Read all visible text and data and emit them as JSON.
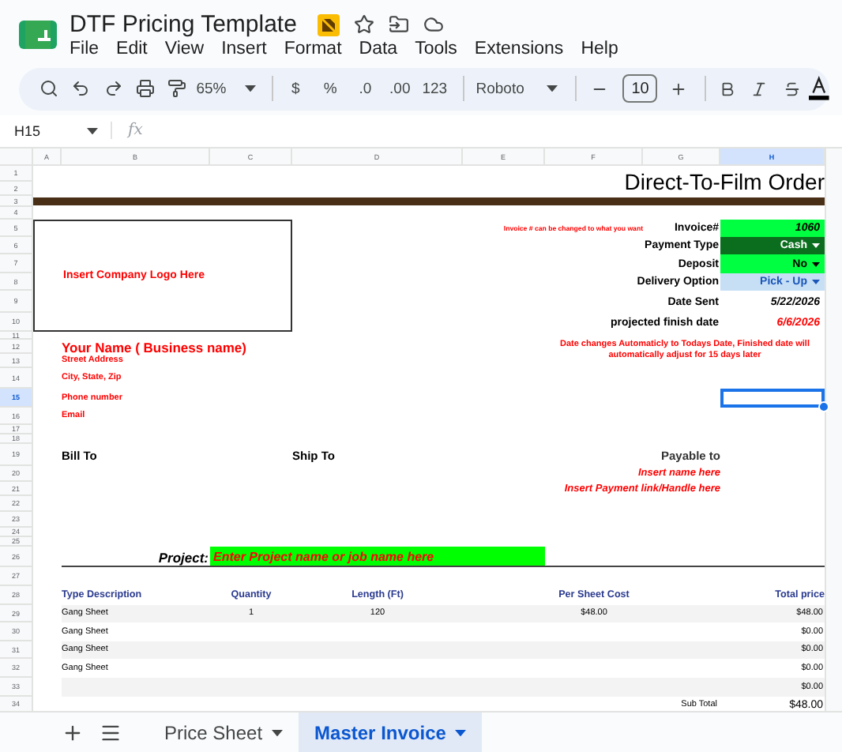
{
  "document": {
    "title": "DTF Pricing Template"
  },
  "menu": [
    "File",
    "Edit",
    "View",
    "Insert",
    "Format",
    "Data",
    "Tools",
    "Extensions",
    "Help"
  ],
  "toolbar": {
    "zoom": "65%",
    "currency": "$",
    "percent": "%",
    "decrease_decimals": ".0",
    "increase_decimals": ".00",
    "number_format": "123",
    "font": "Roboto",
    "font_size": "10"
  },
  "formula_bar": {
    "name_box": "H15",
    "fx": "fx"
  },
  "columns": [
    {
      "label": "A",
      "selected": false
    },
    {
      "label": "B",
      "selected": false
    },
    {
      "label": "C",
      "selected": false
    },
    {
      "label": "D",
      "selected": false
    },
    {
      "label": "E",
      "selected": false
    },
    {
      "label": "F",
      "selected": false
    },
    {
      "label": "G",
      "selected": false
    },
    {
      "label": "H",
      "selected": true
    }
  ],
  "rows": [
    {
      "label": "1",
      "selected": false
    },
    {
      "label": "2",
      "selected": false
    },
    {
      "label": "3",
      "selected": false
    },
    {
      "label": "4",
      "selected": false
    },
    {
      "label": "5",
      "selected": false
    },
    {
      "label": "6",
      "selected": false
    },
    {
      "label": "7",
      "selected": false
    },
    {
      "label": "8",
      "selected": false
    },
    {
      "label": "9",
      "selected": false
    },
    {
      "label": "10",
      "selected": false
    },
    {
      "label": "11",
      "selected": false
    },
    {
      "label": "12",
      "selected": false
    },
    {
      "label": "13",
      "selected": false
    },
    {
      "label": "14",
      "selected": false
    },
    {
      "label": "15",
      "selected": true
    },
    {
      "label": "16",
      "selected": false
    },
    {
      "label": "17",
      "selected": false
    },
    {
      "label": "18",
      "selected": false
    },
    {
      "label": "19",
      "selected": false
    },
    {
      "label": "20",
      "selected": false
    },
    {
      "label": "21",
      "selected": false
    },
    {
      "label": "22",
      "selected": false
    },
    {
      "label": "23",
      "selected": false
    },
    {
      "label": "24",
      "selected": false
    },
    {
      "label": "25",
      "selected": false
    },
    {
      "label": "26",
      "selected": false
    },
    {
      "label": "27",
      "selected": false
    },
    {
      "label": "28",
      "selected": false
    },
    {
      "label": "29",
      "selected": false
    },
    {
      "label": "30",
      "selected": false
    },
    {
      "label": "31",
      "selected": false
    },
    {
      "label": "32",
      "selected": false
    },
    {
      "label": "33",
      "selected": false
    },
    {
      "label": "34",
      "selected": false
    }
  ],
  "invoice": {
    "title": "Direct-To-Film Order",
    "logo_placeholder": "Insert Company Logo Here",
    "invoice_note": "Invoice # can be changed to what you want",
    "details": [
      {
        "label": "Invoice#",
        "value": "1060",
        "kind": "input",
        "color": "#00ff40"
      },
      {
        "label": "Payment Type",
        "value": "Cash",
        "kind": "dropdown",
        "color": "#0b6e1e"
      },
      {
        "label": "Deposit",
        "value": "No",
        "kind": "dropdown",
        "color": "#00ff40"
      },
      {
        "label": "Delivery Option",
        "value": "Pick - Up",
        "kind": "dropdown",
        "color": "#c6dff5"
      },
      {
        "label": "Date Sent",
        "value": "5/22/2026",
        "kind": "date",
        "color": "#000000"
      },
      {
        "label": "projected finish date",
        "value": "6/6/2026",
        "kind": "date",
        "color": "#ff0000"
      }
    ],
    "business_name": "Your Name ( Business name)",
    "business_lines": [
      "Street Address",
      "City, State, Zip",
      "Phone number",
      "Email"
    ],
    "date_note": "Date changes Automaticly to Todays Date, Finished date will automatically adjust for 15 days later",
    "bill_to": "Bill To",
    "ship_to": "Ship To",
    "payable_to": "Payable to",
    "payable_lines": [
      "Insert name here",
      "Insert Payment link/Handle here"
    ],
    "project_label": "Project:",
    "project_value": "Enter Project name or job name here",
    "table_columns": [
      "Type Description",
      "Quantity",
      "Length (Ft)",
      "Per Sheet Cost",
      "Total price"
    ],
    "table_rows": [
      {
        "description": "Gang Sheet",
        "quantity": "1",
        "length": "120",
        "per_sheet_cost": "$48.00",
        "total": "$48.00"
      },
      {
        "description": "Gang Sheet",
        "total": "$0.00"
      },
      {
        "description": "Gang Sheet",
        "total": "$0.00"
      },
      {
        "description": "Gang Sheet",
        "total": "$0.00"
      },
      {
        "total": "$0.00"
      }
    ],
    "subtotal_label": "Sub Total",
    "subtotal_value": "$48.00"
  },
  "sheet_tabs": [
    {
      "label": "Price Sheet",
      "selected": false
    },
    {
      "label": "Master Invoice",
      "selected": true
    }
  ]
}
